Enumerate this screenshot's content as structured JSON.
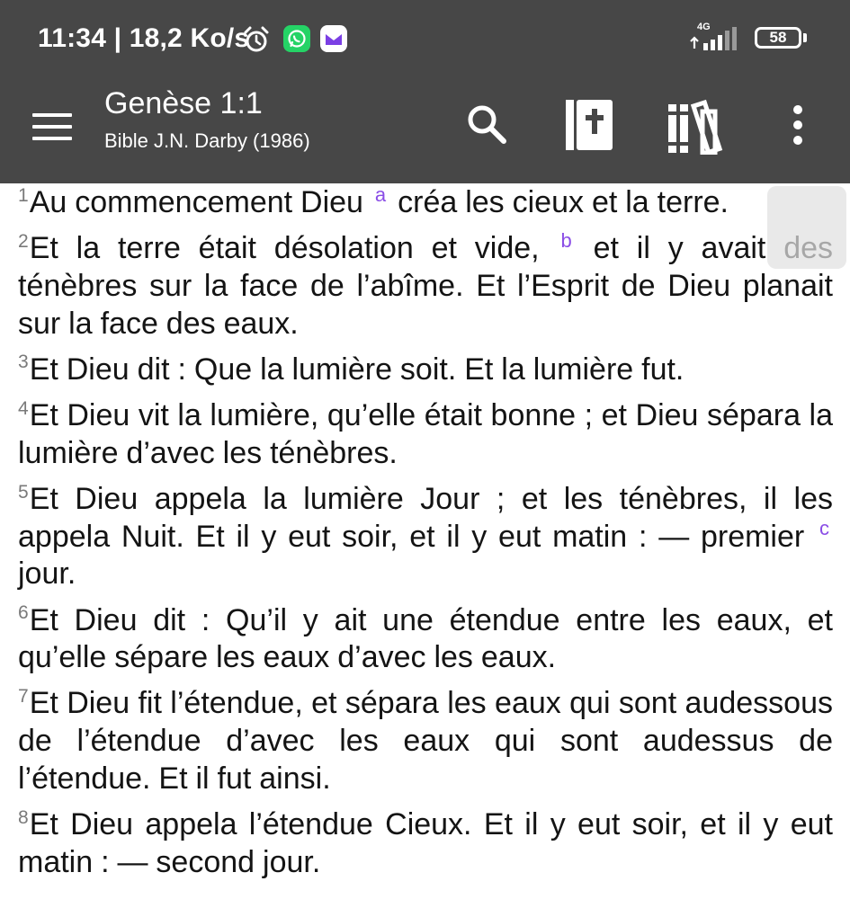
{
  "status": {
    "time": "11:34 | 18,2 Ko/s",
    "network": "4G",
    "battery": "58",
    "icons": [
      "alarm-icon",
      "whatsapp-icon",
      "mail-icon",
      "signal-icon",
      "battery-icon"
    ]
  },
  "appbar": {
    "title": "Genèse 1:1",
    "subtitle": "Bible J.N. Darby (1986)",
    "icons": [
      "menu-icon",
      "search-icon",
      "bible-icon",
      "library-icon",
      "more-vert-icon"
    ]
  },
  "colors": {
    "bar_background": "#474747",
    "note_marker": "#8a4de6",
    "verse_text": "#141414",
    "whatsapp": "#25d366"
  },
  "verses": [
    {
      "num": "1",
      "before": "Au commencement Dieu",
      "note": "a",
      "after": "créa les cieux et la terre."
    },
    {
      "num": "2",
      "before": "Et la terre était désolation et vide,",
      "note": "b",
      "after": "et il y avait des ténèbres sur la face de l’abîme. Et l’Esprit de Dieu planait sur la face des eaux."
    },
    {
      "num": "3",
      "text": "Et Dieu dit : Que la lumière soit. Et la lumière fut."
    },
    {
      "num": "4",
      "text": "Et Dieu vit la lumière, qu’elle était bonne ; et Dieu sé­para la lumière d’avec les ténèbres."
    },
    {
      "num": "5",
      "before": "Et Dieu appela la lumière Jour ; et les ténèbres, il les appela Nuit. Et il y eut soir, et il y eut matin : — pre­mier",
      "note": "c",
      "after": "jour."
    },
    {
      "num": "6",
      "text": "Et Dieu dit : Qu’il y ait une étendue entre les eaux, et qu’elle sépare les eaux d’avec les eaux."
    },
    {
      "num": "7",
      "text": "Et Dieu fit l’étendue, et sépara les eaux qui sont au­dessous de l’étendue d’avec les eaux qui sont au­dessus de l’étendue. Et il fut ainsi."
    },
    {
      "num": "8",
      "text": "Et Dieu appela l’étendue Cieux. Et il y eut soir, et il y eut matin : — second jour."
    }
  ]
}
